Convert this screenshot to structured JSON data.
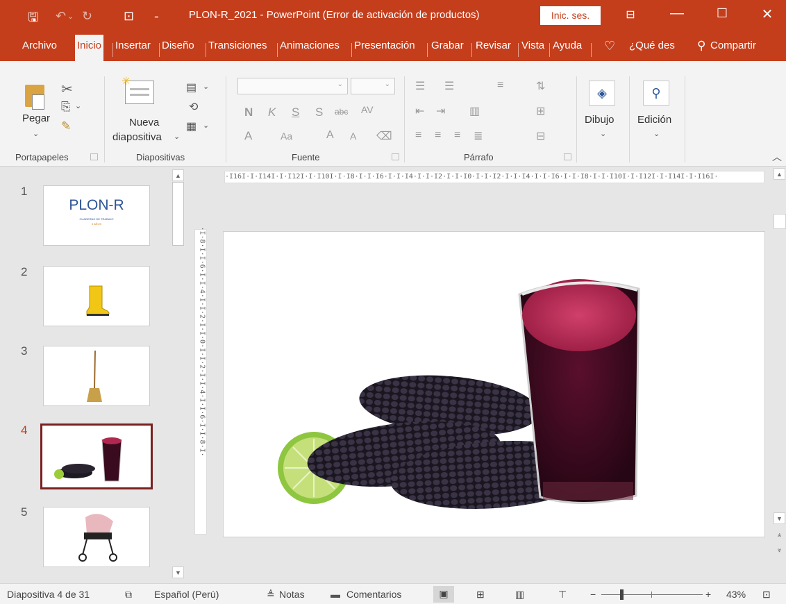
{
  "window": {
    "title": "PLON-R_2021  -  PowerPoint (Error de activación de productos)",
    "signin_label": "Inic. ses.",
    "accent": "#c43e1c"
  },
  "tabs": [
    "Archivo",
    "Inicio",
    "Insertar",
    "Diseño",
    "Transiciones",
    "Animaciones",
    "Presentación",
    "Grabar",
    "Revisar",
    "Vista",
    "Ayuda"
  ],
  "tell_me": "¿Qué des",
  "share_label": "Compartir",
  "ribbon": {
    "paste_label": "Pegar",
    "new_slide_line1": "Nueva",
    "new_slide_line2": "diapositiva",
    "drawing_label": "Dibujo",
    "editing_label": "Edición",
    "font_buttons": [
      "N",
      "K",
      "S",
      "S",
      "abc",
      "AV"
    ],
    "groups": {
      "clipboard": "Portapapeles",
      "slides": "Diapositivas",
      "font": "Fuente",
      "paragraph": "Párrafo"
    }
  },
  "ruler": {
    "horizontal": "·I16I·I·I14I·I·I12I·I·I10I·I·I8·I·I·I6·I·I·I4·I·I·I2·I·I·I0·I·I·I2·I·I·I4·I·I·I6·I·I·I8·I·I·I10I·I·I12I·I·I14I·I·I16I·",
    "vertical": "·I·8·I·I·6·I·I·4·I·I·2·I·I·0·I·I·2·I·I·4·I·I·6·I·I·8·I·"
  },
  "slides": [
    {
      "number": "1",
      "title": "PLON-R",
      "subtitle": "CUADERNO DE TRABAJO",
      "subtitle2": "3 AÑOS"
    },
    {
      "number": "2"
    },
    {
      "number": "3"
    },
    {
      "number": "4"
    },
    {
      "number": "5"
    }
  ],
  "selected_slide": 4,
  "status": {
    "slide_info": "Diapositiva 4 de 31",
    "language": "Español (Perú)",
    "notes": "Notas",
    "comments": "Comentarios",
    "zoom": "43%"
  }
}
